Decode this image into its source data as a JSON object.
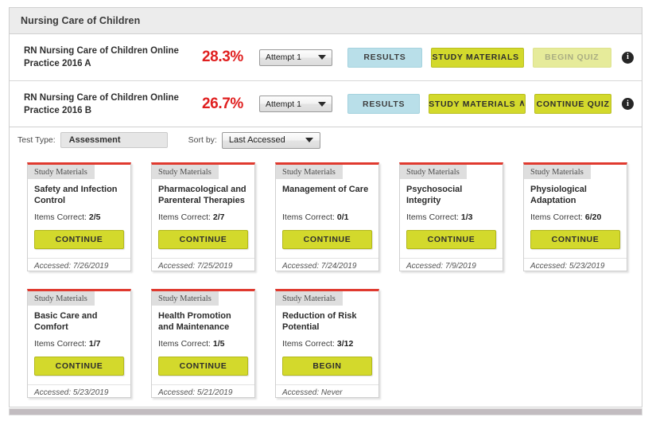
{
  "course": {
    "title": "Nursing Care of Children"
  },
  "attempts": [
    {
      "name": "RN Nursing Care of Children Online Practice 2016 A",
      "score": "28.3%",
      "attempt_select": "Attempt 1",
      "results_label": "RESULTS",
      "study_label": "STUDY MATERIALS",
      "study_chevron": "",
      "quiz_label": "BEGIN QUIZ",
      "quiz_disabled": true,
      "info_glyph": "i"
    },
    {
      "name": "RN Nursing Care of Children Online Practice 2016 B",
      "score": "26.7%",
      "attempt_select": "Attempt 1",
      "results_label": "RESULTS",
      "study_label": "STUDY MATERIALS",
      "study_chevron": "∧",
      "quiz_label": "CONTINUE QUIZ",
      "quiz_disabled": false,
      "info_glyph": "i"
    }
  ],
  "filters": {
    "test_type_label": "Test Type:",
    "test_type_value": "Assessment",
    "sort_by_label": "Sort by:",
    "sort_by_value": "Last Accessed"
  },
  "cards": [
    {
      "tab": "Study Materials",
      "title": "Safety and Infection Control",
      "items_label": "Items Correct:",
      "items_value": "2/5",
      "button": "CONTINUE",
      "accessed": "Accessed: 7/26/2019"
    },
    {
      "tab": "Study Materials",
      "title": "Pharmacological and Parenteral Therapies",
      "items_label": "Items Correct:",
      "items_value": "2/7",
      "button": "CONTINUE",
      "accessed": "Accessed: 7/25/2019"
    },
    {
      "tab": "Study Materials",
      "title": "Management of Care",
      "items_label": "Items Correct:",
      "items_value": "0/1",
      "button": "CONTINUE",
      "accessed": "Accessed: 7/24/2019"
    },
    {
      "tab": "Study Materials",
      "title": "Psychosocial Integrity",
      "items_label": "Items Correct:",
      "items_value": "1/3",
      "button": "CONTINUE",
      "accessed": "Accessed: 7/9/2019"
    },
    {
      "tab": "Study Materials",
      "title": "Physiological Adaptation",
      "items_label": "Items Correct:",
      "items_value": "6/20",
      "button": "CONTINUE",
      "accessed": "Accessed: 5/23/2019"
    },
    {
      "tab": "Study Materials",
      "title": "Basic Care and Comfort",
      "items_label": "Items Correct:",
      "items_value": "1/7",
      "button": "CONTINUE",
      "accessed": "Accessed: 5/23/2019"
    },
    {
      "tab": "Study Materials",
      "title": "Health Promotion and Maintenance",
      "items_label": "Items Correct:",
      "items_value": "1/5",
      "button": "CONTINUE",
      "accessed": "Accessed: 5/21/2019"
    },
    {
      "tab": "Study Materials",
      "title": "Reduction of Risk Potential",
      "items_label": "Items Correct:",
      "items_value": "3/12",
      "button": "BEGIN",
      "accessed": "Accessed: Never"
    }
  ],
  "colors": {
    "score_red": "#e02020",
    "card_top_red": "#e03a2f",
    "primary_yellow": "#d3d92c",
    "disabled_yellow": "#e6eb9a",
    "results_blue": "#b9dfe9",
    "header_gray": "#ececec"
  }
}
